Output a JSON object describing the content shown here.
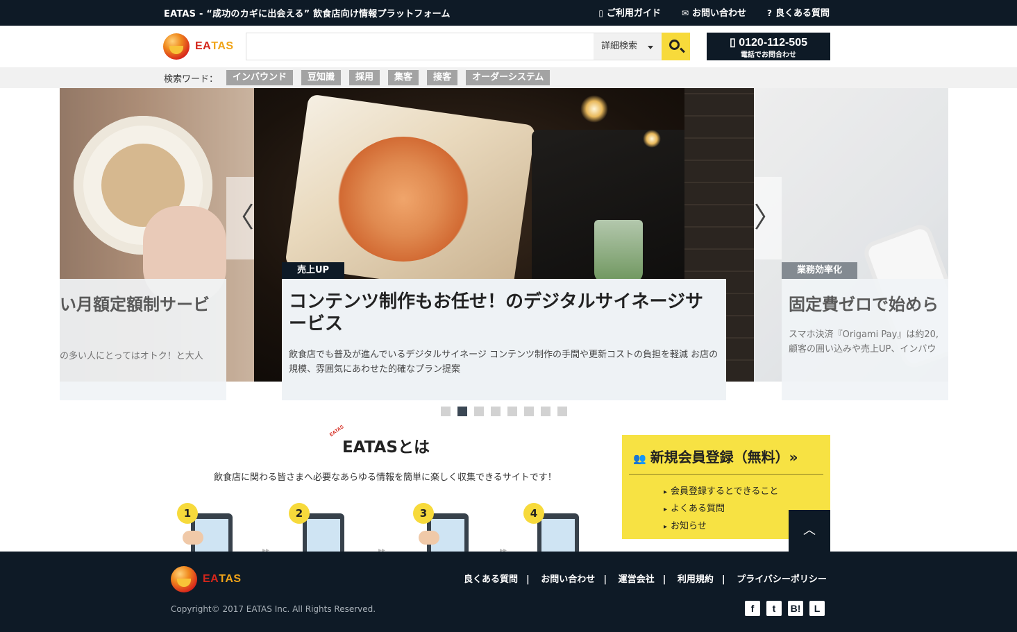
{
  "topbar": {
    "tagline": "EATAS - “成功のカギに出会える” 飲食店向け情報プラットフォーム",
    "links": [
      {
        "icon": "book-icon",
        "glyph": "▯",
        "label": "ご利用ガイド"
      },
      {
        "icon": "mail-icon",
        "glyph": "✉",
        "label": "お問い合わせ"
      },
      {
        "icon": "question-icon",
        "glyph": "?",
        "label": "良くある質問"
      }
    ]
  },
  "header": {
    "logo_text_1": "EA",
    "logo_text_2": "TAS",
    "search_placeholder": "",
    "advanced_label": "詳細検索",
    "phone_number": "▯ 0120-112-505",
    "phone_sub": "電話でお問合わせ"
  },
  "keywords": {
    "label": "検索ワード：",
    "tags": [
      "インバウンド",
      "豆知識",
      "採用",
      "集客",
      "接客",
      "オーダーシステム"
    ]
  },
  "carousel": {
    "prev_label": "〈",
    "next_label": "〉",
    "left_slide": {
      "title": "い月額定額制サービ",
      "desc": "の多い人にとってはオトク！と大人"
    },
    "main_slide": {
      "badge": "売上UP",
      "title": "コンテンツ制作もお任せ！のデジタルサイネージサービス",
      "desc": "飲食店でも普及が進んでいるデジタルサイネージ コンテンツ制作の手間や更新コストの負担を軽減 お店の規模、雰囲気にあわせた的確なプラン提案"
    },
    "right_slide": {
      "badge": "業務効率化",
      "title": "固定費ゼロで始めら",
      "desc_1": "スマホ決済『Origami Pay』は約20,",
      "desc_2": "顧客の囲い込みや売上UP、インバウ"
    },
    "dot_count": 8,
    "active_dot": 2
  },
  "about": {
    "mini_logo": "EATAS",
    "title": "EATASとは",
    "desc": "飲食店に関わる皆さまへ必要なあらゆる情報を簡単に楽しく収集できるサイトです！",
    "steps": [
      "1",
      "2",
      "3",
      "4"
    ]
  },
  "register": {
    "icon": "users-icon",
    "title": "新規会員登録（無料）»",
    "items": [
      "会員登録するとできること",
      "よくある質問",
      "お知らせ"
    ]
  },
  "totop_label": "︿",
  "footer": {
    "links": [
      "良くある質問",
      "お問い合わせ",
      "運営会社",
      "利用規約",
      "プライバシーポリシー"
    ],
    "separator": "|",
    "copyright": "Copyright© 2017 EATAS Inc. All Rights Reserved.",
    "social": [
      {
        "icon": "facebook-icon",
        "glyph": "f"
      },
      {
        "icon": "twitter-icon",
        "glyph": "t"
      },
      {
        "icon": "hatena-icon",
        "glyph": "B!"
      },
      {
        "icon": "line-icon",
        "glyph": "L"
      }
    ]
  },
  "colors": {
    "navy": "#0e1a26",
    "yellow": "#f7da3b",
    "register_yellow": "#f7e243",
    "tag_gray": "#a3a3a3",
    "logo_red": "#d4261b"
  }
}
